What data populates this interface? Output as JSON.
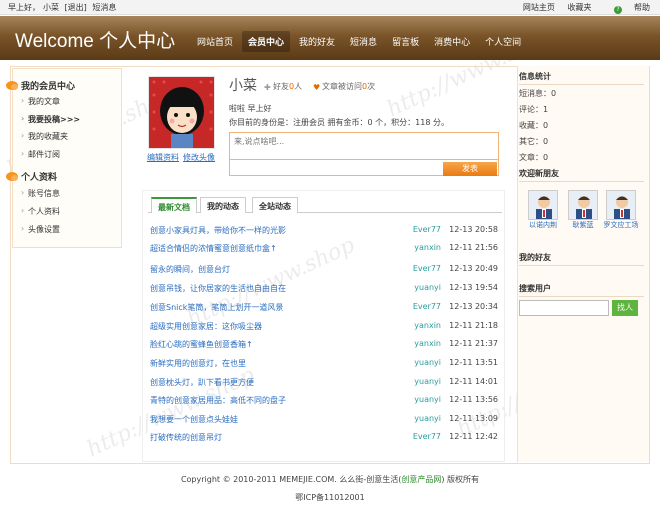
{
  "topbar": {
    "greeting": "早上好，",
    "user": "小菜",
    "logout": "[退出]",
    "messages": "短消息",
    "home": "网站主页",
    "favorite": "收藏夹",
    "help": "帮助"
  },
  "header": {
    "logo": "Welcome 个人中心",
    "nav": [
      "网站首页",
      "会员中心",
      "我的好友",
      "短消息",
      "留言板",
      "消费中心",
      "个人空间"
    ]
  },
  "sidebar": {
    "section1_title": "我的会员中心",
    "section1_items": [
      "我的文章",
      "我要投稿>>>",
      "我的收藏夹",
      "邮件订阅"
    ],
    "section2_title": "个人资料",
    "section2_items": [
      "账号信息",
      "个人资料",
      "头像设置"
    ]
  },
  "profile": {
    "username": "小菜",
    "friends_label": "好友",
    "friends_count": "0",
    "friends_unit": "人",
    "visits_label": "文章被访问",
    "visits_count": "0",
    "visits_unit": "次",
    "greeting": "啦啦 早上好",
    "identity": "你目前的身份是：注册会员 拥有金币：0 个，积分：118 分。",
    "edit_profile": "编辑资料",
    "edit_avatar": "修改头像",
    "say_placeholder": "来,说点啥吧...",
    "post_button": "发表"
  },
  "tabs": [
    "最新文档",
    "我的动态",
    "全站动态"
  ],
  "feed": [
    {
      "title": "创意小家具灯具，带给你不一样的光影",
      "user": "Ever77",
      "time": "12-13 20:58"
    },
    {
      "title": "超适合情侣的浓情蜜意创意纸巾盒↑",
      "user": "yanxin",
      "time": "12-11 21:56"
    },
    {
      "title": "留永的瞬间，创意台灯",
      "user": "Ever77",
      "time": "12-13 20:49"
    },
    {
      "title": "创意吊钱，让你居家的生活也自由自在",
      "user": "yuanyi",
      "time": "12-13 19:54"
    },
    {
      "title": "创意Snick笔筒，笔筒上划开一道风景",
      "user": "Ever77",
      "time": "12-13 20:34"
    },
    {
      "title": "超级实用创意家居：这你吸尘器",
      "user": "yanxin",
      "time": "12-11 21:18"
    },
    {
      "title": "脸红心跳的蜜蜂鱼创意香箱↑",
      "user": "yanxin",
      "time": "12-11 21:37"
    },
    {
      "title": "新鲜实用的创意灯，在也里",
      "user": "yuanyi",
      "time": "12-11 13:51"
    },
    {
      "title": "创意枕头灯，趴下看书更方便",
      "user": "yuanyi",
      "time": "12-11 14:01"
    },
    {
      "title": "青特的创意家居用品：高低不同的盘子",
      "user": "yuanyi",
      "time": "12-11 13:56"
    },
    {
      "title": "我想要一个创意点头娃娃",
      "user": "yuanyi",
      "time": "12-11 13:09"
    },
    {
      "title": "打破传统的创意吊灯",
      "user": "Ever77",
      "time": "12-11 12:42"
    }
  ],
  "right": {
    "stats_title": "信息统计",
    "stats": [
      "短消息：0",
      "评论：1",
      "收藏：0",
      "其它：0",
      "文章：0"
    ],
    "new_friends_title": "欢迎新朋友",
    "friends": [
      "以诺内荆",
      "耿紫蓝",
      "罗文应工场"
    ],
    "my_friends_title": "我的好友",
    "search_title": "搜索用户",
    "search_button": "找人"
  },
  "footer": {
    "line1_prefix": "Copyright © 2010-2011 MEMEJIE.COM. 么么街-创意生活(",
    "line1_link": "创意产品网",
    "line1_suffix": ") 版权所有",
    "line2": "鄂ICP备11012001"
  }
}
